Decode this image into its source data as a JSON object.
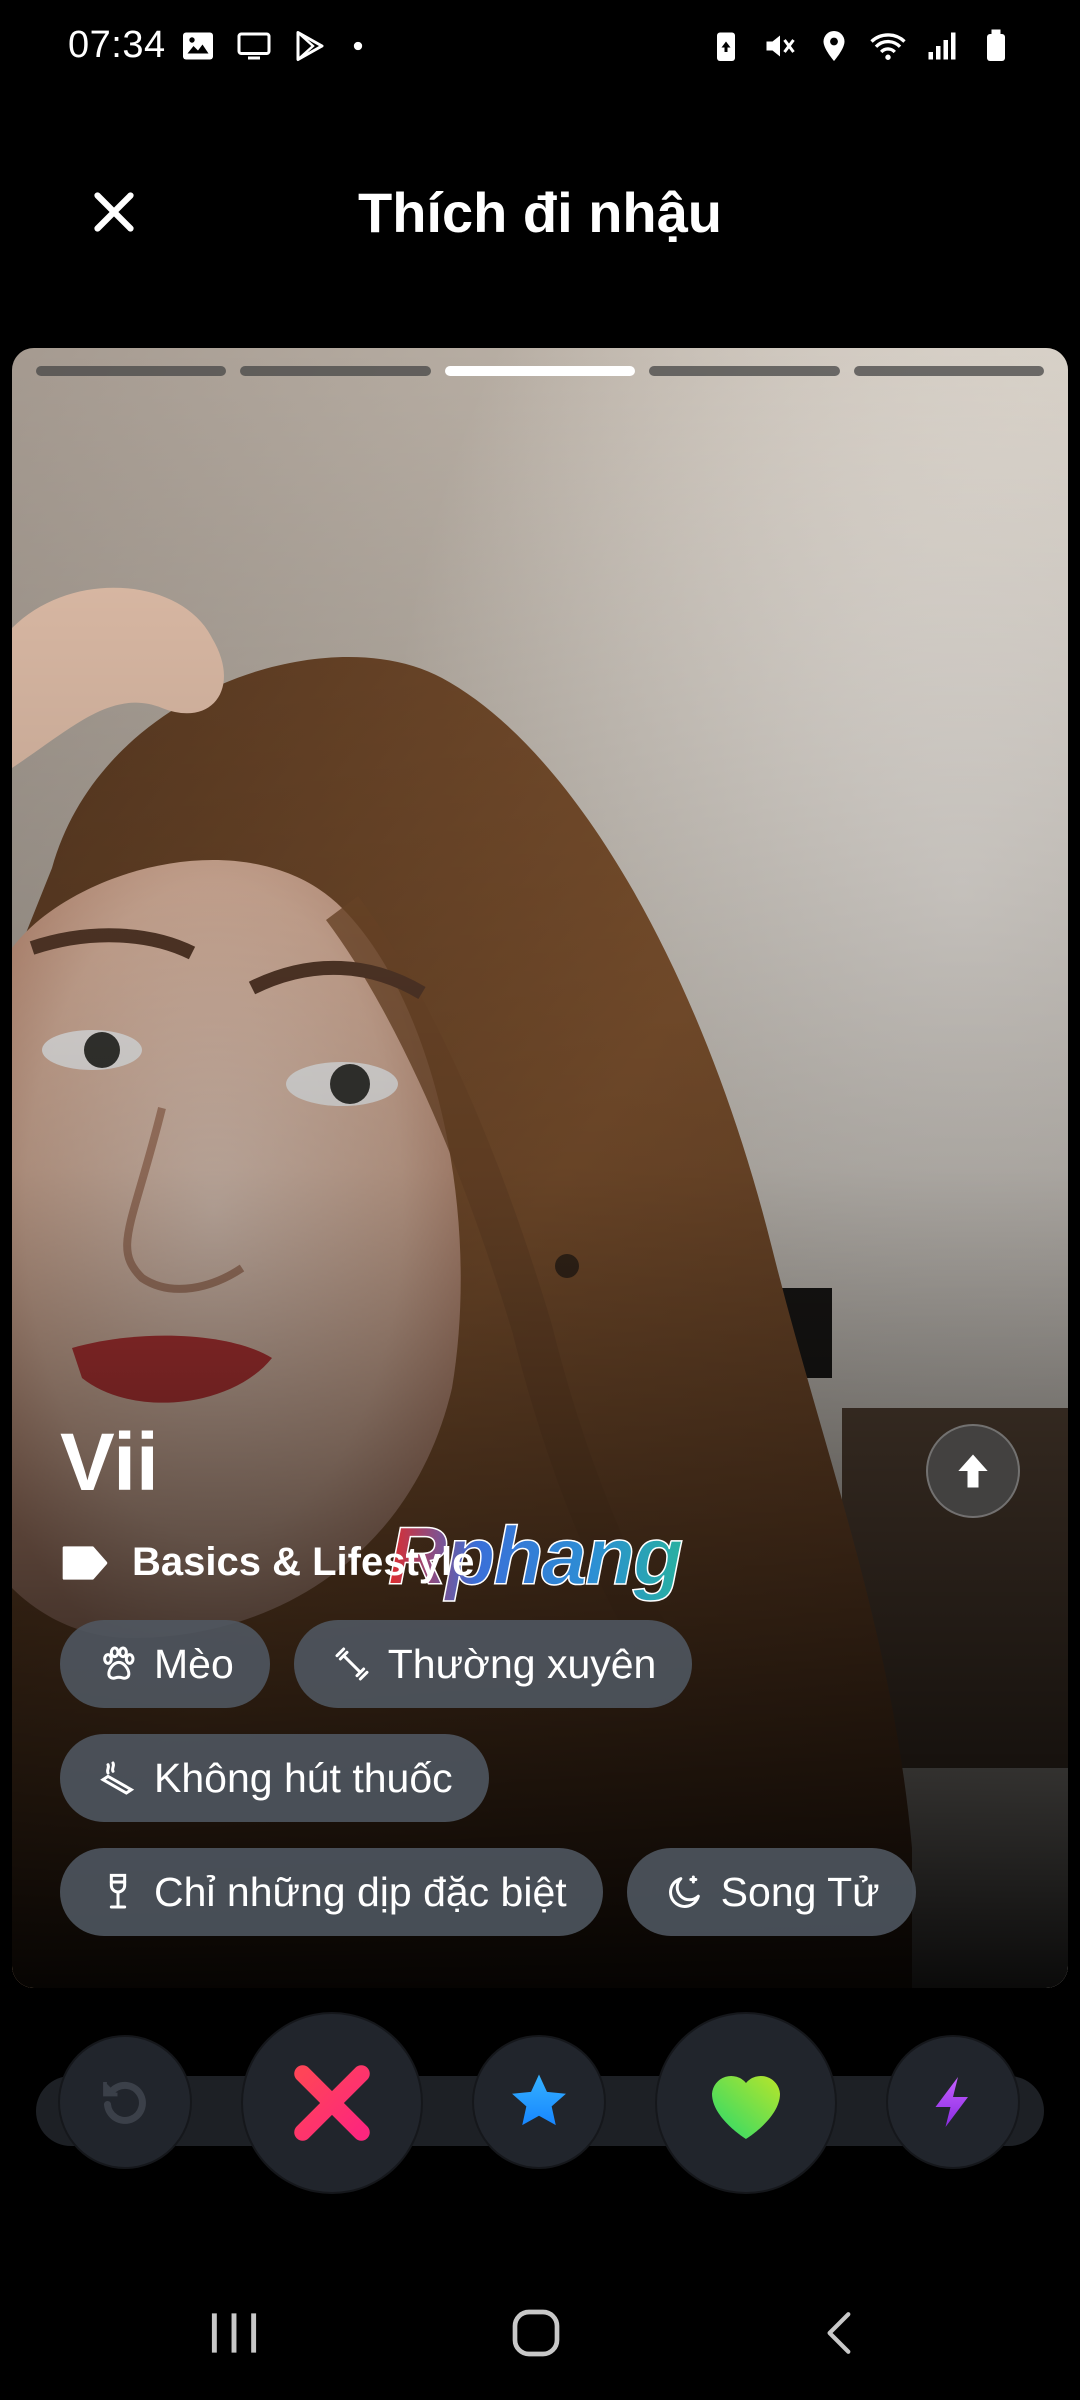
{
  "status_bar": {
    "time": "07:34",
    "left_icons": [
      "gallery-icon",
      "cast-icon",
      "play-store-icon",
      "dot-icon"
    ],
    "right_icons": [
      "battery-saver-icon",
      "mute-icon",
      "location-icon",
      "wifi-icon",
      "signal-icon",
      "battery-icon"
    ]
  },
  "header": {
    "title": "Thích đi nhậu",
    "close_icon": "close-icon"
  },
  "card": {
    "photo_count": 5,
    "active_photo_index": 3,
    "name": "Vii",
    "watermark": "Rphang",
    "section": {
      "icon": "tag-icon",
      "label": "Basics & Lifestyle"
    },
    "chips": [
      [
        {
          "icon": "paw-icon",
          "label": "Mèo"
        },
        {
          "icon": "dumbbell-icon",
          "label": "Thường xuyên"
        }
      ],
      [
        {
          "icon": "cigarette-icon",
          "label": "Không hút thuốc"
        }
      ],
      [
        {
          "icon": "wine-glass-icon",
          "label": "Chỉ những dịp đặc biệt"
        },
        {
          "icon": "moon-icon",
          "label": "Song Tử"
        }
      ]
    ]
  },
  "actions": [
    "rewind-icon",
    "nope-x-icon",
    "super-like-star-icon",
    "like-heart-icon",
    "boost-bolt-icon"
  ],
  "colors": {
    "nope": "#fd267d",
    "star": "#1786ff",
    "like_start": "#26d96e",
    "like_end": "#b8e52a",
    "boost": "#a93cf6",
    "chip_bg": "#505862"
  },
  "nav": [
    "recent-apps-icon",
    "home-icon",
    "back-icon"
  ]
}
